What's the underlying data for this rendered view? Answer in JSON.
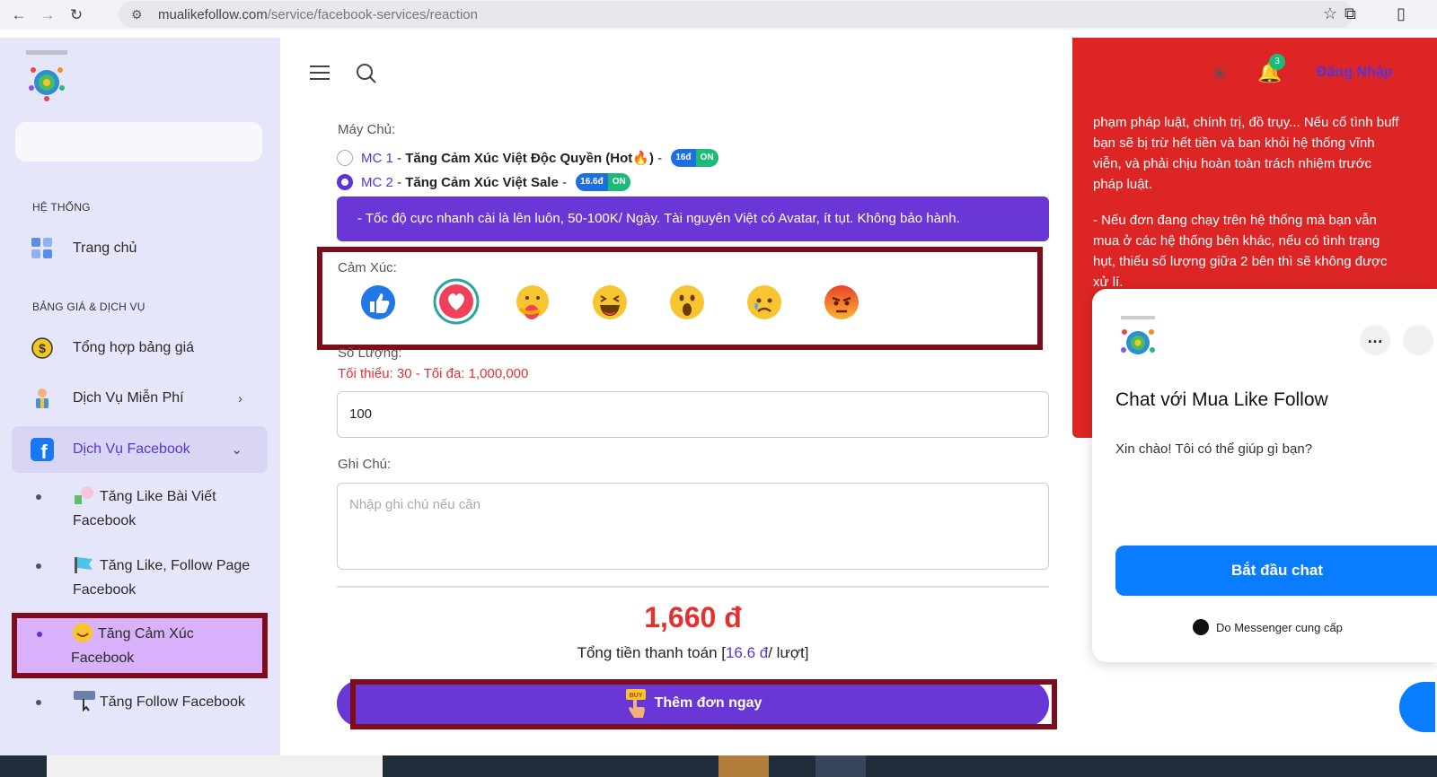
{
  "browser": {
    "url_domain": "mualikefollow.com",
    "url_path": "/service/facebook-services/reaction"
  },
  "sidebar": {
    "section_system": "HỆ THỐNG",
    "home": "Trang chủ",
    "section_pricing": "BẢNG GIÁ & DỊCH VỤ",
    "pricing": "Tổng hợp bảng giá",
    "free": "Dịch Vụ Miễn Phí",
    "facebook": "Dịch Vụ Facebook",
    "sub": [
      {
        "label": "Tăng Like Bài Viết Facebook"
      },
      {
        "label": "Tăng Like, Follow Page Facebook"
      },
      {
        "label": "Tăng Cảm Xúc Facebook"
      },
      {
        "label": "Tăng Follow Facebook"
      }
    ]
  },
  "header": {
    "notif_count": "3",
    "login": "Đăng Nhập"
  },
  "form": {
    "server_label": "Máy Chủ:",
    "servers": [
      {
        "code": "MC 1",
        "sep": " - ",
        "name": "Tăng Cảm Xúc Việt Độc Quyền (Hot🔥)",
        "dash": " - ",
        "price": "16đ",
        "status": "ON",
        "selected": false
      },
      {
        "code": "MC 2",
        "sep": " - ",
        "name": "Tăng Cảm Xúc Việt Sale",
        "dash": " - ",
        "price": "16.6đ",
        "status": "ON",
        "selected": true
      }
    ],
    "server_info": "- Tốc độ cực nhanh cài là lên luôn, 50-100K/ Ngày. Tài nguyên Việt có Avatar, ít tụt. Không bảo hành.",
    "reaction_label": "Cảm Xúc:",
    "reactions": [
      "like",
      "love",
      "care",
      "haha",
      "wow",
      "sad",
      "angry"
    ],
    "selected_reaction": "love",
    "quantity_label": "Số Lượng:",
    "quantity_limits": "Tối thiểu: 30 - Tối đa: 1,000,000",
    "quantity_value": "100",
    "note_label": "Ghi Chú:",
    "note_placeholder": "Nhập ghi chú nếu cần",
    "price": "1,660 đ",
    "total_prefix": "Tổng tiền thanh toán [",
    "total_unit": "16.6 đ",
    "total_suffix": "/ lượt]",
    "submit": "Thêm đơn ngay"
  },
  "notice": {
    "p1": "phạm pháp luật, chính trị, đồ trụy... Nếu cố tình buff bạn sẽ bị trừ hết tiền và ban khỏi hệ thống vĩnh viễn, và phải chịu hoàn toàn trách nhiệm trước pháp luật.",
    "p2": "- Nếu đơn đang chạy trên hệ thống mà bạn vẫn mua ở các hệ thống bên khác, nếu có tình trạng hụt, thiếu số lượng giữa 2 bên thì sẽ không được xử lí."
  },
  "chat": {
    "title": "Chat với Mua Like Follow",
    "greeting": "Xin chào! Tôi có thể giúp gì bạn?",
    "start": "Bắt đầu chat",
    "powered": "Do Messenger cung cấp"
  },
  "colors": {
    "accent": "#6a36d6",
    "danger": "#e33030",
    "notice": "#dd2525",
    "messenger": "#0a7cff"
  }
}
